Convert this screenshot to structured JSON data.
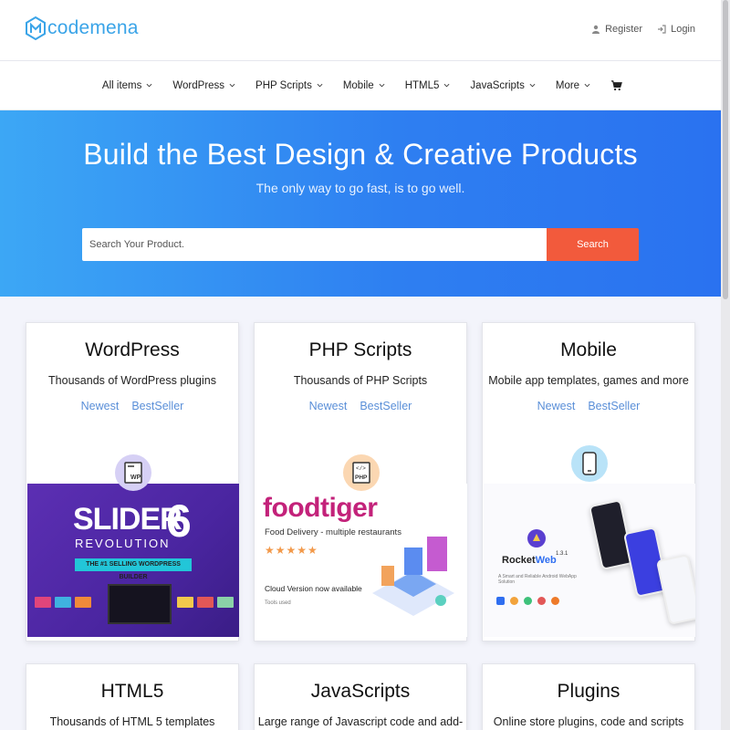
{
  "header": {
    "logo_text": "codemena",
    "register_label": "Register",
    "login_label": "Login"
  },
  "nav": {
    "items": [
      {
        "label": "All items"
      },
      {
        "label": "WordPress"
      },
      {
        "label": "PHP Scripts"
      },
      {
        "label": "Mobile"
      },
      {
        "label": "HTML5"
      },
      {
        "label": "JavaScripts"
      },
      {
        "label": "More"
      }
    ],
    "cart_icon": "cart-icon"
  },
  "hero": {
    "title": "Build the Best Design & Creative Products",
    "subtitle": "The only way to go fast, is to go well.",
    "search_placeholder": "Search Your Product.",
    "search_button": "Search"
  },
  "cards": [
    {
      "title": "WordPress",
      "desc": "Thousands of WordPress plugins",
      "link_newest": "Newest",
      "link_bestseller": "BestSeller",
      "badge_icon": "wordpress-file-icon",
      "banner": {
        "title": "SLIDER",
        "number": "6",
        "subtitle": "REVOLUTION",
        "tag": "THE #1 SELLING WORDPRESS BUILDER"
      }
    },
    {
      "title": "PHP Scripts",
      "desc": "Thousands of PHP Scripts",
      "link_newest": "Newest",
      "link_bestseller": "BestSeller",
      "badge_icon": "php-file-icon",
      "banner": {
        "logo": "foodtiger",
        "subtitle": "Food Delivery - multiple restaurants",
        "stars": "★★★★★",
        "cloud": "Cloud Version now available",
        "tools": "Tools used"
      }
    },
    {
      "title": "Mobile",
      "desc": "Mobile app templates, games and more",
      "link_newest": "Newest",
      "link_bestseller": "BestSeller",
      "badge_icon": "smartphone-icon",
      "banner": {
        "logo_a": "Rocket",
        "logo_b": "Web",
        "version": "1.3.1",
        "desc": "A Smart and Reliable Android WebApp Solution"
      }
    },
    {
      "title": "HTML5",
      "desc": "Thousands of HTML 5 templates"
    },
    {
      "title": "JavaScripts",
      "desc": "Large range of Javascript code and add-ons"
    },
    {
      "title": "Plugins",
      "desc": "Online store plugins, code and scripts"
    }
  ],
  "colors": {
    "accent": "#3aa4e8",
    "hero_start": "#3ca7f5",
    "hero_end": "#2a72f0",
    "search_button": "#f25a3c",
    "link": "#5a8fd8"
  }
}
